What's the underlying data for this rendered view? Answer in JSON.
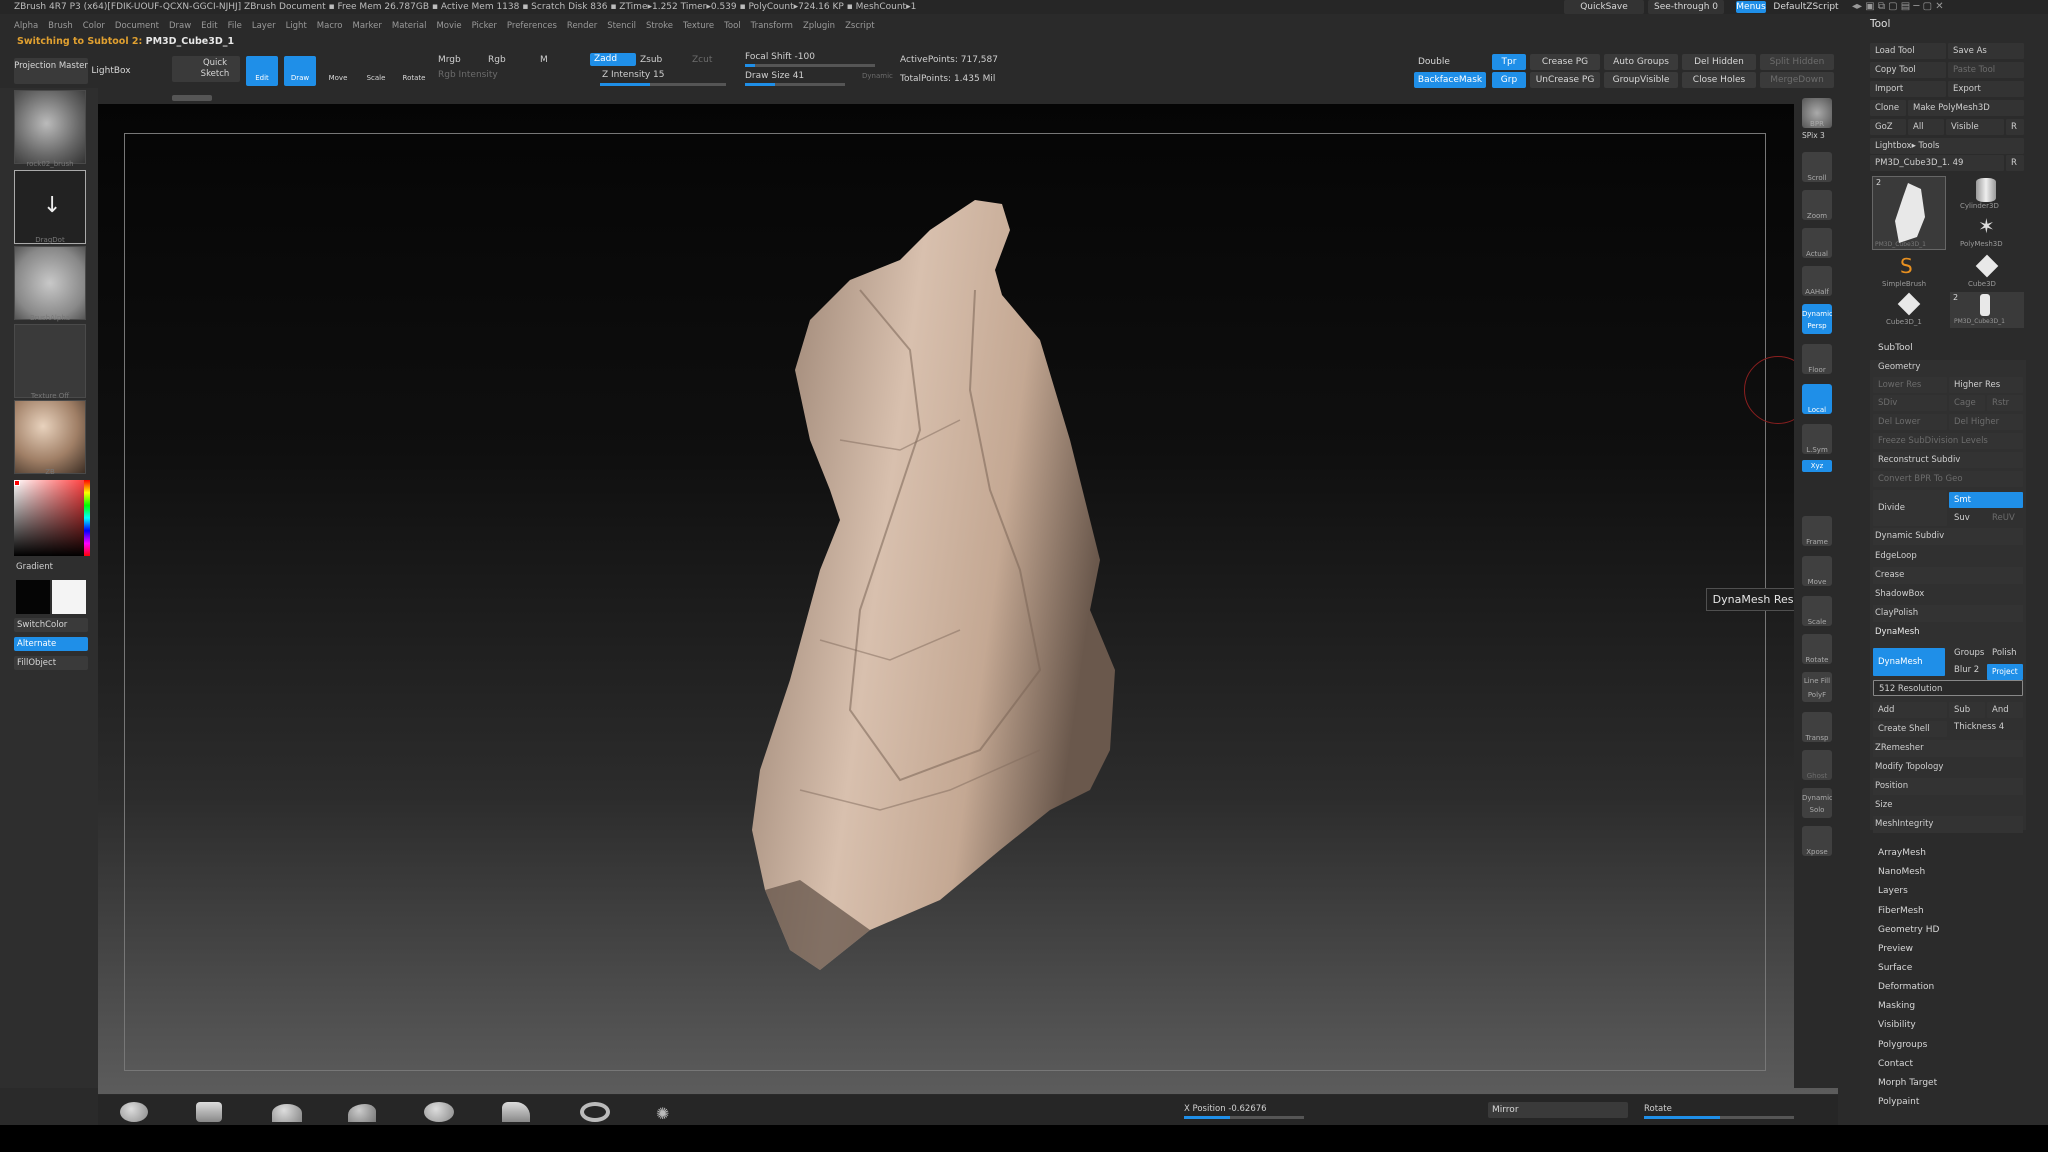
{
  "titlebar": {
    "text": "ZBrush 4R7 P3 (x64)[FDIK-UOUF-QCXN-GGCI-NJHJ]    ZBrush Document      ▪ Free Mem 26.787GB ▪ Active Mem 1138 ▪ Scratch Disk 836 ▪ ZTime▸1.252 Timer▸0.539 ▪ PolyCount▸724.16 KP ▪ MeshCount▸1",
    "quicksave": "QuickSave",
    "seethrough": "See-through  0",
    "menus": "Menus",
    "script": "DefaultZScript"
  },
  "menubar": [
    "Alpha",
    "Brush",
    "Color",
    "Document",
    "Draw",
    "Edit",
    "File",
    "Layer",
    "Light",
    "Macro",
    "Marker",
    "Material",
    "Movie",
    "Picker",
    "Preferences",
    "Render",
    "Stencil",
    "Stroke",
    "Texture",
    "Tool",
    "Transform",
    "Zplugin",
    "Zscript"
  ],
  "subtool_message": {
    "prefix": "Switching to Subtool 2:",
    "name": "PM3D_Cube3D_1"
  },
  "toptools": {
    "projection_master": "Projection Master",
    "lightbox": "LightBox",
    "quick_sketch": "Quick Sketch",
    "edit": "Edit",
    "draw": "Draw",
    "move": "Move",
    "scale": "Scale",
    "rotate": "Rotate",
    "mrgb": "Mrgb",
    "rgb": "Rgb",
    "m": "M",
    "rgb_intensity": "Rgb Intensity",
    "zadd": "Zadd",
    "zsub": "Zsub",
    "zcut": "Zcut",
    "z_intensity": "Z Intensity 15",
    "focal_shift": "Focal Shift -100",
    "draw_size": "Draw Size 41",
    "dynamic": "Dynamic",
    "active_points": "ActivePoints: 717,587",
    "total_points": "TotalPoints: 1.435 Mil",
    "double": "Double",
    "backface": "BackfaceMask",
    "tpr": "Tpr",
    "grp": "Grp",
    "crease_pg": "Crease PG",
    "uncrease_pg": "UnCrease PG",
    "auto_groups": "Auto Groups",
    "group_visible": "GroupVisible",
    "del_hidden": "Del Hidden",
    "close_holes": "Close Holes",
    "split_hidden": "Split Hidden",
    "merge_down": "MergeDown"
  },
  "leftpanel": {
    "brush_caption": "rock02_brush",
    "stroke_caption": "DragDot",
    "alpha_caption": "BrushAlpha",
    "texture_caption": "Texture Off",
    "material_caption": "ZB",
    "gradient": "Gradient",
    "switchcolor": "SwitchColor",
    "alternate": "Alternate",
    "fillobject": "FillObject"
  },
  "rightshelf": [
    "BPR",
    "SPix 3",
    "Scroll",
    "Zoom",
    "Actual",
    "AAHalf",
    "Dynamic Persp",
    "Floor",
    "Local",
    "L.Sym",
    "Xyz",
    "Frame",
    "Move",
    "Scale",
    "Rotate",
    "Line Fill PolyF",
    "Transp",
    "Ghost",
    "Dynamic Solo",
    "Xpose"
  ],
  "toolpanel": {
    "title": "Tool",
    "load_tool": "Load Tool",
    "save_as": "Save As",
    "copy_tool": "Copy Tool",
    "paste_tool": "Paste Tool",
    "import": "Import",
    "export": "Export",
    "clone": "Clone",
    "make_polymesh": "Make PolyMesh3D",
    "goz": "GoZ",
    "all": "All",
    "visible": "Visible",
    "r": "R",
    "lightbox_tools": "Lightbox▸ Tools",
    "current_tool": "PM3D_Cube3D_1. 49",
    "r2": "R",
    "tool_thumbs": [
      "PM3D_Cube3D_1",
      "Cylinder3D",
      "PolyMesh3D",
      "SimpleBrush",
      "Cube3D",
      "Cube3D_1",
      "PM3D_Cube3D_1"
    ],
    "tool_counts": [
      "2",
      "2"
    ],
    "subtool": "SubTool",
    "geometry": "Geometry",
    "lower_res": "Lower Res",
    "higher_res": "Higher Res",
    "sdiv": "SDiv",
    "cage": "Cage",
    "rstr": "Rstr",
    "del_lower": "Del Lower",
    "del_higher": "Del Higher",
    "freeze": "Freeze SubDivision Levels",
    "reconstruct": "Reconstruct Subdiv",
    "convert_bpr": "Convert BPR To Geo",
    "divide": "Divide",
    "smt": "Smt",
    "suv": "Suv",
    "reuv": "ReUV",
    "dynamic_subdiv": "Dynamic Subdiv",
    "edgeloop": "EdgeLoop",
    "crease": "Crease",
    "shadowbox": "ShadowBox",
    "claypolish": "ClayPolish",
    "dynamesh_header": "DynaMesh",
    "dynamesh_btn": "DynaMesh",
    "groups": "Groups",
    "polish": "Polish",
    "blur": "Blur 2",
    "project": "Project",
    "resolution": "512 Resolution",
    "add": "Add",
    "sub": "Sub",
    "and": "And",
    "create_shell": "Create Shell",
    "thickness": "Thickness 4",
    "zremesher": "ZRemesher",
    "modify_topology": "Modify Topology",
    "position": "Position",
    "size": "Size",
    "meshintegrity": "MeshIntegrity",
    "sections": [
      "ArrayMesh",
      "NanoMesh",
      "Layers",
      "FiberMesh",
      "Geometry HD",
      "Preview",
      "Surface",
      "Deformation",
      "Masking",
      "Visibility",
      "Polygroups",
      "Contact",
      "Morph Target",
      "Polypaint"
    ]
  },
  "tooltip": "DynaMesh Resolution",
  "bottombar": {
    "x_position": "X Position -0.62676",
    "mirror": "Mirror",
    "rotate": "Rotate"
  },
  "colors": {
    "accent": "#1f8fe8",
    "warn": "#e0a030",
    "rock": "#c8ad9a"
  }
}
